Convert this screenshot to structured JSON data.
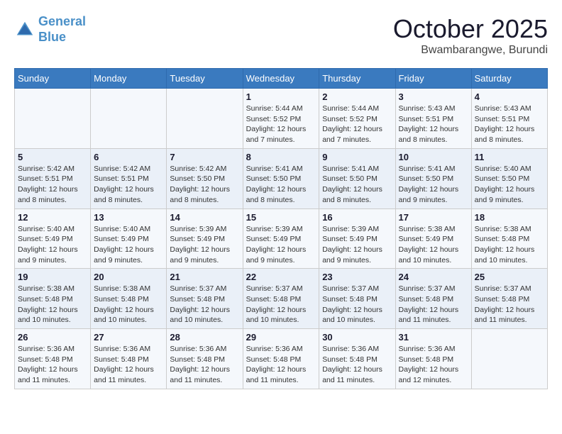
{
  "header": {
    "logo_line1": "General",
    "logo_line2": "Blue",
    "month_year": "October 2025",
    "location": "Bwambarangwe, Burundi"
  },
  "weekdays": [
    "Sunday",
    "Monday",
    "Tuesday",
    "Wednesday",
    "Thursday",
    "Friday",
    "Saturday"
  ],
  "weeks": [
    [
      {
        "day": "",
        "info": ""
      },
      {
        "day": "",
        "info": ""
      },
      {
        "day": "",
        "info": ""
      },
      {
        "day": "1",
        "info": "Sunrise: 5:44 AM\nSunset: 5:52 PM\nDaylight: 12 hours and 7 minutes."
      },
      {
        "day": "2",
        "info": "Sunrise: 5:44 AM\nSunset: 5:52 PM\nDaylight: 12 hours and 7 minutes."
      },
      {
        "day": "3",
        "info": "Sunrise: 5:43 AM\nSunset: 5:51 PM\nDaylight: 12 hours and 8 minutes."
      },
      {
        "day": "4",
        "info": "Sunrise: 5:43 AM\nSunset: 5:51 PM\nDaylight: 12 hours and 8 minutes."
      }
    ],
    [
      {
        "day": "5",
        "info": "Sunrise: 5:42 AM\nSunset: 5:51 PM\nDaylight: 12 hours and 8 minutes."
      },
      {
        "day": "6",
        "info": "Sunrise: 5:42 AM\nSunset: 5:51 PM\nDaylight: 12 hours and 8 minutes."
      },
      {
        "day": "7",
        "info": "Sunrise: 5:42 AM\nSunset: 5:50 PM\nDaylight: 12 hours and 8 minutes."
      },
      {
        "day": "8",
        "info": "Sunrise: 5:41 AM\nSunset: 5:50 PM\nDaylight: 12 hours and 8 minutes."
      },
      {
        "day": "9",
        "info": "Sunrise: 5:41 AM\nSunset: 5:50 PM\nDaylight: 12 hours and 8 minutes."
      },
      {
        "day": "10",
        "info": "Sunrise: 5:41 AM\nSunset: 5:50 PM\nDaylight: 12 hours and 9 minutes."
      },
      {
        "day": "11",
        "info": "Sunrise: 5:40 AM\nSunset: 5:50 PM\nDaylight: 12 hours and 9 minutes."
      }
    ],
    [
      {
        "day": "12",
        "info": "Sunrise: 5:40 AM\nSunset: 5:49 PM\nDaylight: 12 hours and 9 minutes."
      },
      {
        "day": "13",
        "info": "Sunrise: 5:40 AM\nSunset: 5:49 PM\nDaylight: 12 hours and 9 minutes."
      },
      {
        "day": "14",
        "info": "Sunrise: 5:39 AM\nSunset: 5:49 PM\nDaylight: 12 hours and 9 minutes."
      },
      {
        "day": "15",
        "info": "Sunrise: 5:39 AM\nSunset: 5:49 PM\nDaylight: 12 hours and 9 minutes."
      },
      {
        "day": "16",
        "info": "Sunrise: 5:39 AM\nSunset: 5:49 PM\nDaylight: 12 hours and 9 minutes."
      },
      {
        "day": "17",
        "info": "Sunrise: 5:38 AM\nSunset: 5:49 PM\nDaylight: 12 hours and 10 minutes."
      },
      {
        "day": "18",
        "info": "Sunrise: 5:38 AM\nSunset: 5:48 PM\nDaylight: 12 hours and 10 minutes."
      }
    ],
    [
      {
        "day": "19",
        "info": "Sunrise: 5:38 AM\nSunset: 5:48 PM\nDaylight: 12 hours and 10 minutes."
      },
      {
        "day": "20",
        "info": "Sunrise: 5:38 AM\nSunset: 5:48 PM\nDaylight: 12 hours and 10 minutes."
      },
      {
        "day": "21",
        "info": "Sunrise: 5:37 AM\nSunset: 5:48 PM\nDaylight: 12 hours and 10 minutes."
      },
      {
        "day": "22",
        "info": "Sunrise: 5:37 AM\nSunset: 5:48 PM\nDaylight: 12 hours and 10 minutes."
      },
      {
        "day": "23",
        "info": "Sunrise: 5:37 AM\nSunset: 5:48 PM\nDaylight: 12 hours and 10 minutes."
      },
      {
        "day": "24",
        "info": "Sunrise: 5:37 AM\nSunset: 5:48 PM\nDaylight: 12 hours and 11 minutes."
      },
      {
        "day": "25",
        "info": "Sunrise: 5:37 AM\nSunset: 5:48 PM\nDaylight: 12 hours and 11 minutes."
      }
    ],
    [
      {
        "day": "26",
        "info": "Sunrise: 5:36 AM\nSunset: 5:48 PM\nDaylight: 12 hours and 11 minutes."
      },
      {
        "day": "27",
        "info": "Sunrise: 5:36 AM\nSunset: 5:48 PM\nDaylight: 12 hours and 11 minutes."
      },
      {
        "day": "28",
        "info": "Sunrise: 5:36 AM\nSunset: 5:48 PM\nDaylight: 12 hours and 11 minutes."
      },
      {
        "day": "29",
        "info": "Sunrise: 5:36 AM\nSunset: 5:48 PM\nDaylight: 12 hours and 11 minutes."
      },
      {
        "day": "30",
        "info": "Sunrise: 5:36 AM\nSunset: 5:48 PM\nDaylight: 12 hours and 11 minutes."
      },
      {
        "day": "31",
        "info": "Sunrise: 5:36 AM\nSunset: 5:48 PM\nDaylight: 12 hours and 12 minutes."
      },
      {
        "day": "",
        "info": ""
      }
    ]
  ]
}
